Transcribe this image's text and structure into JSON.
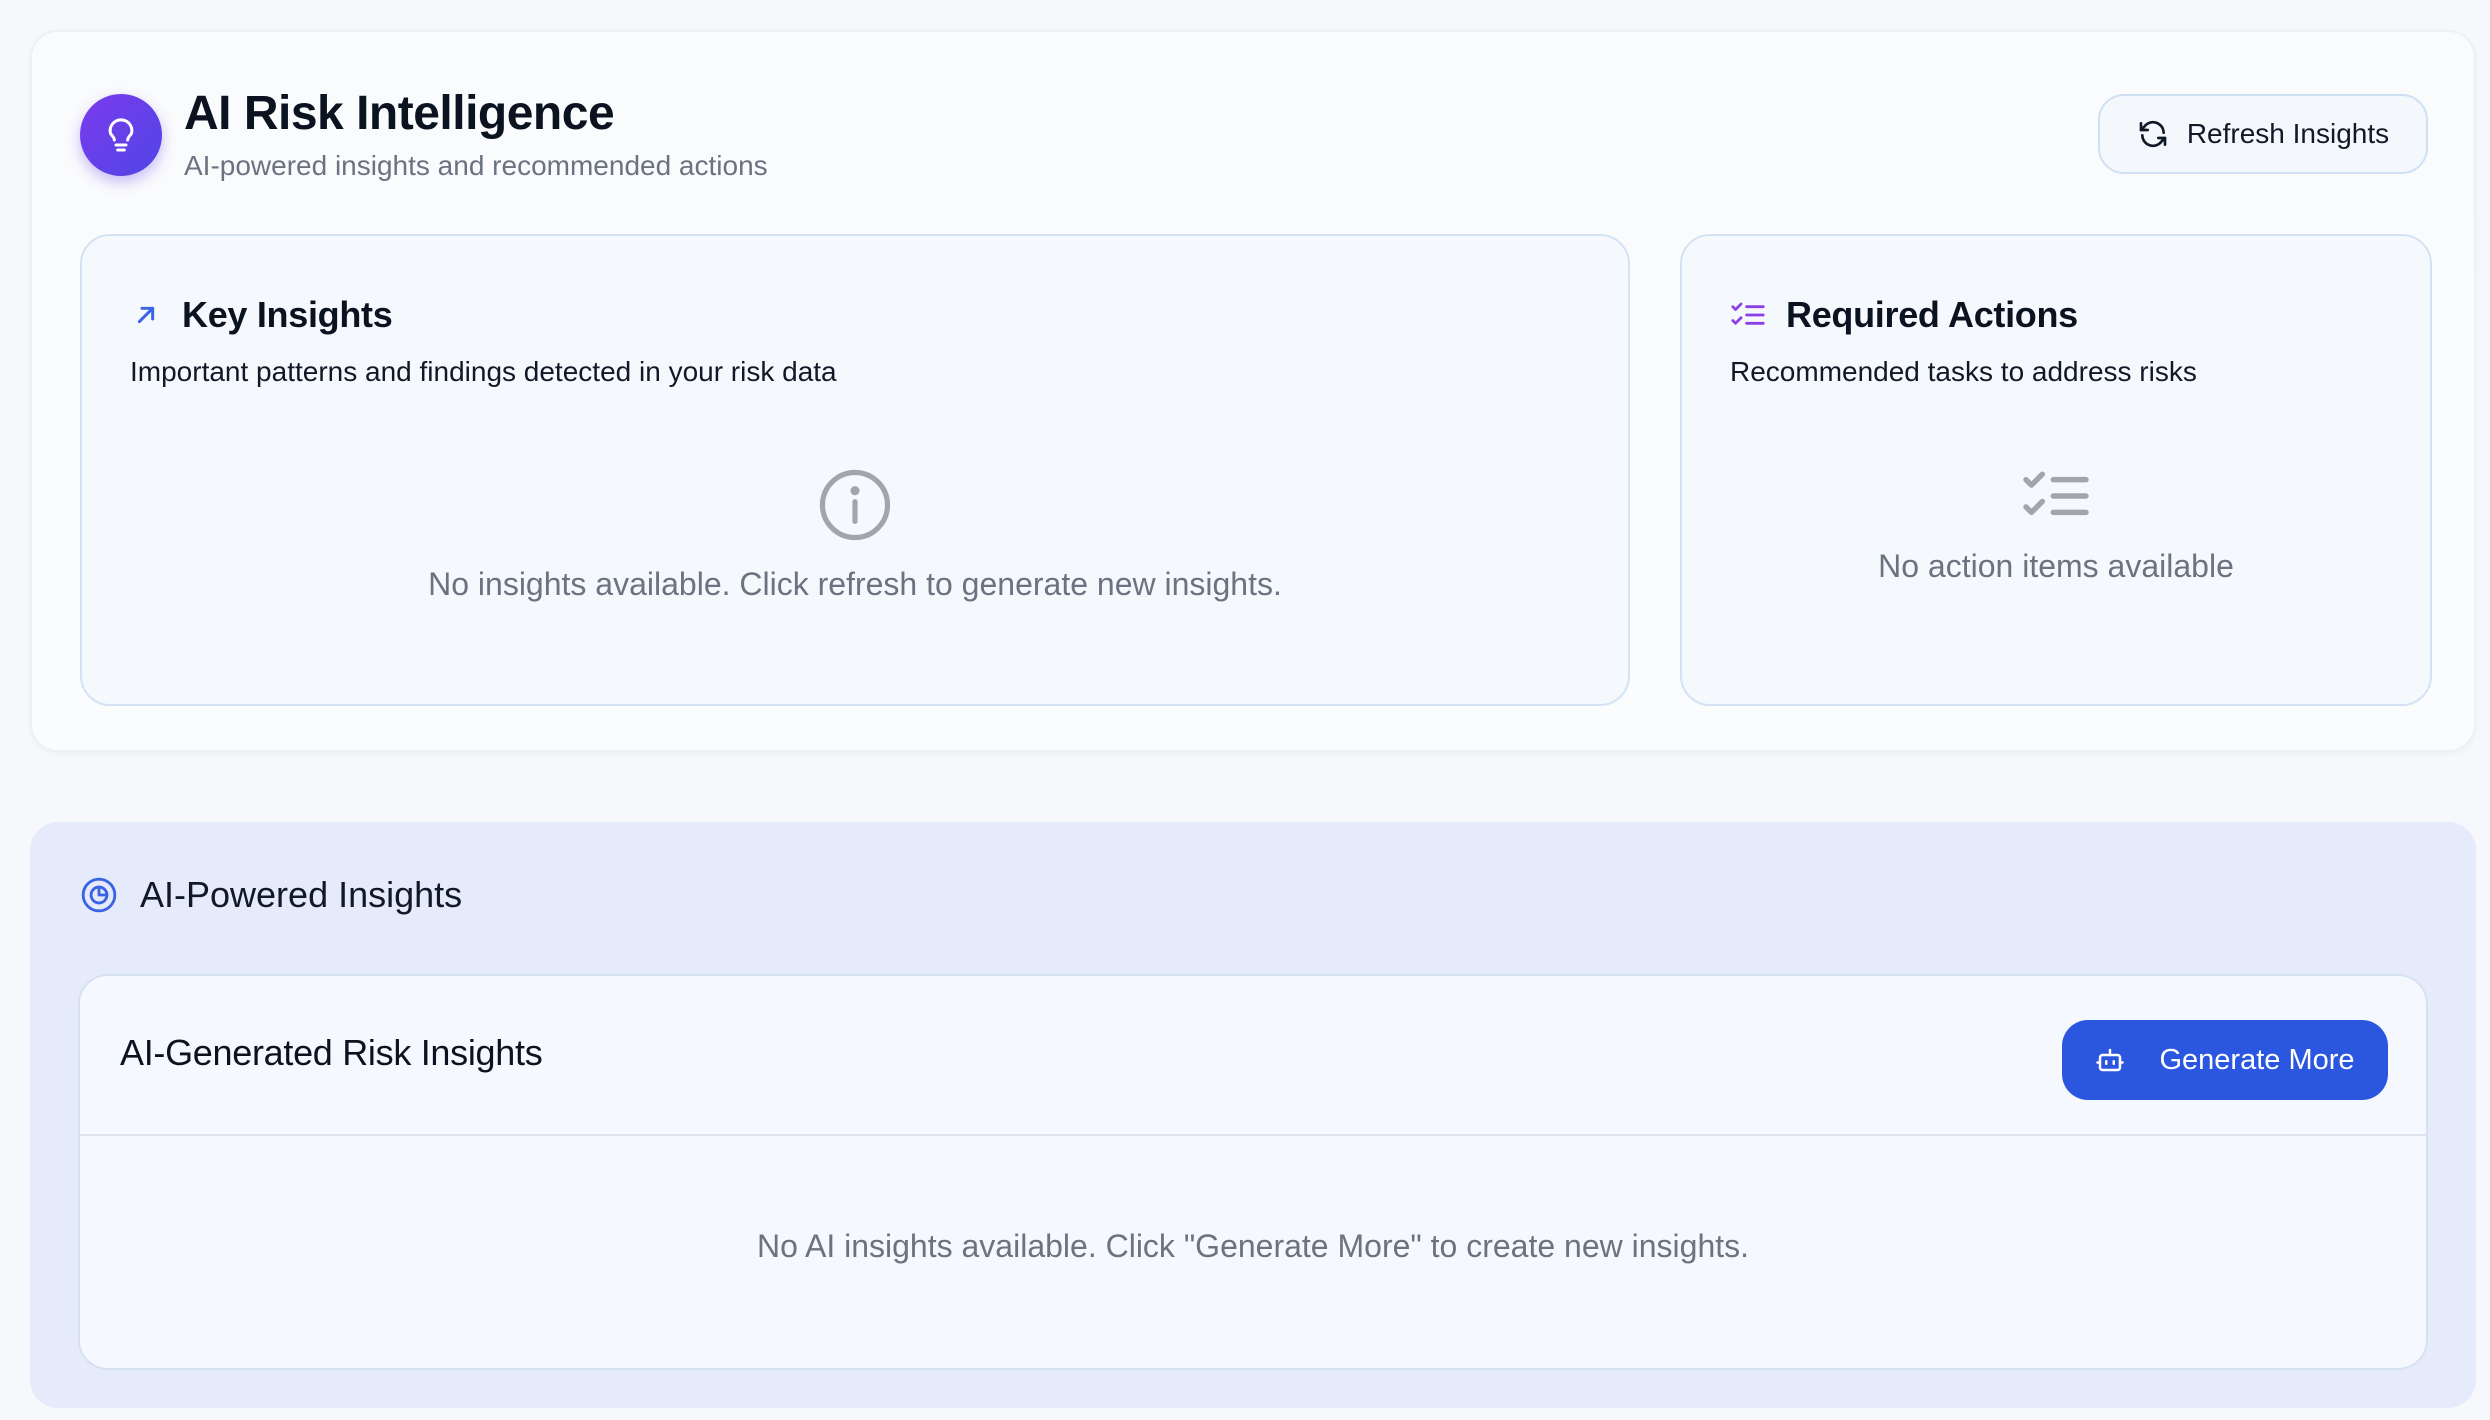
{
  "header": {
    "title": "AI Risk Intelligence",
    "subtitle": "AI-powered insights and recommended actions",
    "refresh_label": "Refresh Insights",
    "icon": "lightbulb-icon"
  },
  "key_insights": {
    "title": "Key Insights",
    "description": "Important patterns and findings detected in your risk data",
    "empty_text": "No insights available. Click refresh to generate new insights.",
    "icon": "trend-arrow-icon",
    "empty_icon": "info-icon"
  },
  "required_actions": {
    "title": "Required Actions",
    "description": "Recommended tasks to address risks",
    "empty_text": "No action items available",
    "icon": "checklist-icon"
  },
  "ai_powered": {
    "section_title": "AI-Powered Insights",
    "card_title": "AI-Generated Risk Insights",
    "generate_label": "Generate More",
    "empty_text": "No AI insights available. Click \"Generate More\" to create new insights.",
    "icon": "pie-chart-icon",
    "button_icon": "robot-icon"
  },
  "colors": {
    "accent_purple": "#6d3ee8",
    "accent_blue": "#2b57e0",
    "card_border": "#d3e3f4",
    "muted_text": "#6b7280"
  }
}
